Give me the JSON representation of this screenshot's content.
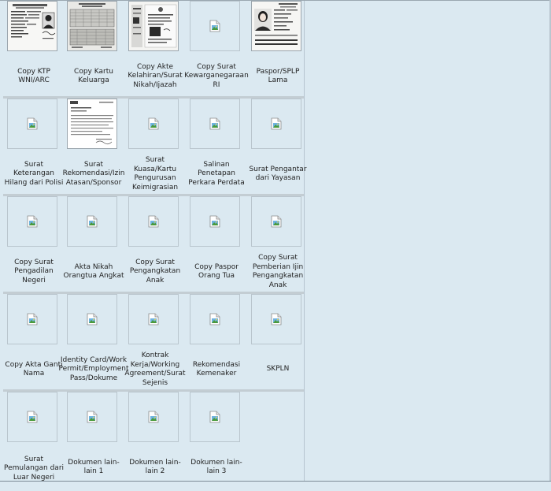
{
  "documents": [
    {
      "label": "Copy KTP WNI/ARC",
      "thumbnail": "ktp-card"
    },
    {
      "label": "Copy Kartu Keluarga",
      "thumbnail": "family-card"
    },
    {
      "label": "Copy Akte Kelahiran/Surat Nikah/Ijazah",
      "thumbnail": "certificate"
    },
    {
      "label": "Copy Surat Kewarganegaraan RI",
      "thumbnail": "broken"
    },
    {
      "label": "Paspor/SPLP Lama",
      "thumbnail": "passport"
    },
    {
      "label": "Surat Keterangan Hilang dari Polisi",
      "thumbnail": "broken"
    },
    {
      "label": "Surat Rekomendasi/Izin Atasan/Sponsor",
      "thumbnail": "letter"
    },
    {
      "label": "Surat Kuasa/Kartu Pengurusan Keimigrasian",
      "thumbnail": "broken"
    },
    {
      "label": "Salinan Penetapan Perkara Perdata",
      "thumbnail": "broken"
    },
    {
      "label": "Surat Pengantar dari Yayasan",
      "thumbnail": "broken"
    },
    {
      "label": "Copy Surat Pengadilan Negeri",
      "thumbnail": "broken"
    },
    {
      "label": "Akta Nikah Orangtua Angkat",
      "thumbnail": "broken"
    },
    {
      "label": "Copy Surat Pengangkatan Anak",
      "thumbnail": "broken"
    },
    {
      "label": "Copy Paspor Orang Tua",
      "thumbnail": "broken"
    },
    {
      "label": "Copy Surat Pemberian Ijin Pengangkatan Anak",
      "thumbnail": "broken"
    },
    {
      "label": "Copy Akta Ganti Nama",
      "thumbnail": "broken"
    },
    {
      "label": "Identity Card/Work Permit/Employment Pass/Dokume",
      "thumbnail": "broken"
    },
    {
      "label": "Kontrak Kerja/Working Agreement/Surat Sejenis",
      "thumbnail": "broken"
    },
    {
      "label": "Rekomendasi Kemenaker",
      "thumbnail": "broken"
    },
    {
      "label": "SKPLN",
      "thumbnail": "broken"
    },
    {
      "label": "Surat Pemulangan dari Luar Negeri",
      "thumbnail": "broken"
    },
    {
      "label": "Dokumen lain-lain 1",
      "thumbnail": "broken"
    },
    {
      "label": "Dokumen lain-lain 2",
      "thumbnail": "broken"
    },
    {
      "label": "Dokumen lain-lain 3",
      "thumbnail": "broken"
    }
  ],
  "colors": {
    "page_background": "#dbe9f1",
    "row_separator": "#c3cdd3",
    "thumbnail_border": "#b9c5cd"
  }
}
